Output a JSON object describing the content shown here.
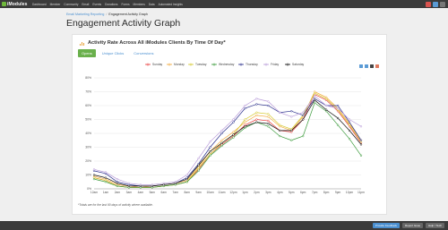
{
  "app": {
    "logo_text": "iModules"
  },
  "topnav": {
    "items": [
      "Dashboard",
      "Member",
      "Community",
      "Email",
      "Events",
      "Donations",
      "Forms",
      "Members",
      "Data",
      "Automated Insights"
    ]
  },
  "breadcrumb": {
    "parent": "Email Marketing Reporting",
    "current": "Engagement Activity Graph"
  },
  "page": {
    "title": "Engagement Activity Graph"
  },
  "card": {
    "title": "Activity Rate Across All iModules Clients By Time Of Day*",
    "footnote": "*Totals are for the last 90 days of activity where available."
  },
  "tabs": [
    {
      "label": "Opens",
      "active": true
    },
    {
      "label": "Unique Clicks",
      "active": false
    },
    {
      "label": "Conversions",
      "active": false
    }
  ],
  "bottombar": {
    "buttons": [
      "Provide Feedback",
      "Report Issue",
      "Help / Tech"
    ]
  },
  "colors": {
    "accent_green": "#6ab04c",
    "link_blue": "#4a8fd0",
    "topbar": "#3b3b3b"
  },
  "chart_data": {
    "type": "line",
    "title": "",
    "xlabel": "",
    "ylabel": "",
    "ylim": [
      0,
      80
    ],
    "y_ticks": [
      "0%",
      "10%",
      "20%",
      "30%",
      "40%",
      "50%",
      "60%",
      "70%",
      "80%"
    ],
    "grid": true,
    "legend_position": "top-center",
    "categories": [
      "12am",
      "1am",
      "2am",
      "3am",
      "4am",
      "5am",
      "6am",
      "7am",
      "8am",
      "9am",
      "10am",
      "11am",
      "12pm",
      "1pm",
      "2pm",
      "3pm",
      "4pm",
      "5pm",
      "6pm",
      "7pm",
      "8pm",
      "9pm",
      "10pm",
      "11pm"
    ],
    "series": [
      {
        "name": "Sunday",
        "color": "#e83e3e",
        "values": [
          8,
          6,
          2,
          1,
          1,
          1,
          2,
          3,
          5,
          14,
          25,
          32,
          38,
          46,
          50,
          49,
          42,
          41,
          50,
          68,
          64,
          56,
          45,
          33
        ]
      },
      {
        "name": "Monday",
        "color": "#f2a93b",
        "values": [
          9,
          7,
          3,
          2,
          1,
          2,
          3,
          4,
          6,
          16,
          27,
          35,
          41,
          48,
          53,
          52,
          45,
          42,
          52,
          70,
          66,
          58,
          47,
          35
        ]
      },
      {
        "name": "Tuesday",
        "color": "#d4c82a",
        "values": [
          8,
          6,
          2,
          1,
          1,
          1,
          2,
          3,
          5,
          15,
          25,
          33,
          39,
          50,
          55,
          54,
          46,
          43,
          53,
          69,
          65,
          57,
          46,
          34
        ]
      },
      {
        "name": "Wednesday",
        "color": "#3a9a3a",
        "values": [
          7,
          5,
          2,
          1,
          1,
          1,
          2,
          3,
          5,
          13,
          24,
          31,
          37,
          44,
          48,
          45,
          38,
          35,
          38,
          62,
          56,
          46,
          36,
          24
        ]
      },
      {
        "name": "Thursday",
        "color": "#2a2f8c",
        "values": [
          13,
          11,
          5,
          3,
          2,
          2,
          3,
          4,
          8,
          18,
          30,
          40,
          48,
          58,
          61,
          60,
          55,
          56,
          53,
          65,
          60,
          60,
          48,
          35
        ]
      },
      {
        "name": "Friday",
        "color": "#b79ad8",
        "values": [
          14,
          12,
          7,
          4,
          3,
          3,
          4,
          5,
          10,
          22,
          34,
          42,
          50,
          60,
          65,
          63,
          55,
          52,
          55,
          67,
          60,
          58,
          50,
          45
        ]
      },
      {
        "name": "Saturday",
        "color": "#111111",
        "values": [
          10,
          8,
          4,
          2,
          2,
          2,
          3,
          4,
          7,
          17,
          27,
          33,
          39,
          45,
          48,
          47,
          42,
          42,
          50,
          64,
          57,
          51,
          42,
          32
        ]
      }
    ]
  }
}
